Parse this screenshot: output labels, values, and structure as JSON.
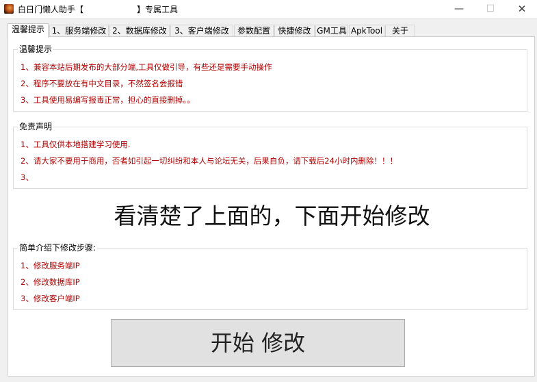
{
  "window": {
    "title_prefix": "白日门懒人助手【",
    "title_suffix": "】专属工具",
    "minimize": "—",
    "maximize": "☐",
    "close": "✕"
  },
  "tabs": [
    {
      "label": "温馨提示",
      "active": true
    },
    {
      "label": "1、服务端修改"
    },
    {
      "label": "2、数据库修改"
    },
    {
      "label": "3、客户端修改"
    },
    {
      "label": "参数配置"
    },
    {
      "label": "快捷修改"
    },
    {
      "label": "GM工具"
    },
    {
      "label": "ApkTool"
    },
    {
      "label": "关于"
    }
  ],
  "tips": {
    "title": "温馨提示",
    "lines": [
      "1、兼容本站后期发布的大部分端,工具仅做引导，有些还是需要手动操作",
      "2、程序不要放在有中文目录，不然签名会报错",
      "3、工具使用易编写报毒正常，担心的直接删掉。。"
    ]
  },
  "disclaimer": {
    "title": "免责声明",
    "lines": [
      "1、工具仅供本地搭建学习使用.",
      "2、请大家不要用于商用，否者如引起一切纠纷和本人与论坛无关，后果自负，请下载后24小时内删除！！！",
      "3、"
    ]
  },
  "headline": "看清楚了上面的，下面开始修改",
  "steps": {
    "title": "简单介绍下修改步骤:",
    "lines": [
      "1、修改服务端IP",
      "2、修改数据库IP",
      "3、修改客户端IP"
    ]
  },
  "start_button": "开始 修改",
  "colors": {
    "text_red": "#b00000",
    "panel_bg": "#ffffff",
    "window_bg": "#f0f0f0"
  }
}
